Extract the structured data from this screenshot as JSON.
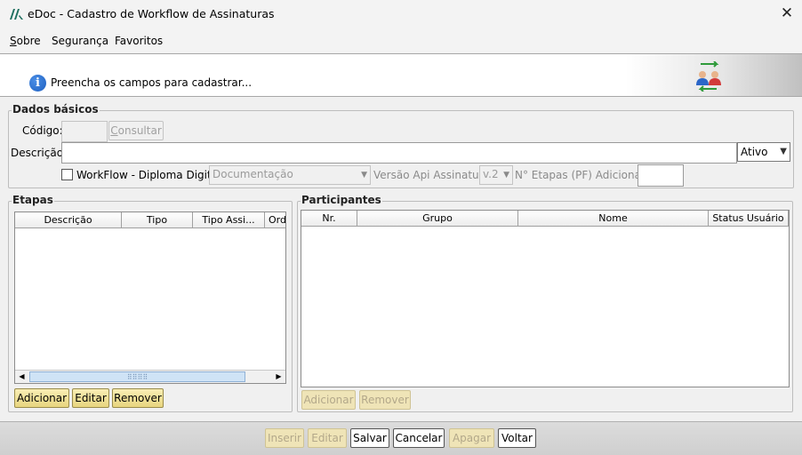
{
  "window": {
    "title": "eDoc - Cadastro de Workflow de Assinaturas",
    "close_icon": "close-icon"
  },
  "menu": {
    "items": [
      {
        "label": "Sobre"
      },
      {
        "label": "Segurança"
      },
      {
        "label": "Favoritos"
      }
    ]
  },
  "banner": {
    "message": "Preencha os campos para cadastrar...",
    "icon": "info-icon",
    "side_icon": "users-exchange-icon"
  },
  "dados_basicos": {
    "legend": "Dados básicos",
    "codigo_label": "Código:",
    "codigo_value": "",
    "consultar_label": "Consultar",
    "descricao_label": "Descrição:",
    "descricao_value": "",
    "status_selected": "Ativo",
    "workflow_checkbox_label": "WorkFlow - Diploma Digital",
    "workflow_checked": false,
    "documentacao_selected": "Documentação",
    "versao_label": "Versão Api Assinatura:",
    "versao_selected": "v.2",
    "etapas_label": "N° Etapas (PF) Adicionais:",
    "etapas_value": ""
  },
  "etapas": {
    "legend": "Etapas",
    "columns": [
      "Descrição",
      "Tipo",
      "Tipo Assi...",
      "Ord"
    ],
    "rows": [],
    "buttons": {
      "adicionar": "Adicionar",
      "editar": "Editar",
      "remover": "Remover"
    }
  },
  "participantes": {
    "legend": "Participantes",
    "columns": [
      "Nr.",
      "Grupo",
      "Nome",
      "Status Usuário"
    ],
    "rows": [],
    "buttons": {
      "adicionar": "Adicionar",
      "remover": "Remover"
    }
  },
  "toolbar": {
    "inserir": "Inserir",
    "editar": "Editar",
    "salvar": "Salvar",
    "cancelar": "Cancelar",
    "apagar": "Apagar",
    "voltar": "Voltar"
  }
}
